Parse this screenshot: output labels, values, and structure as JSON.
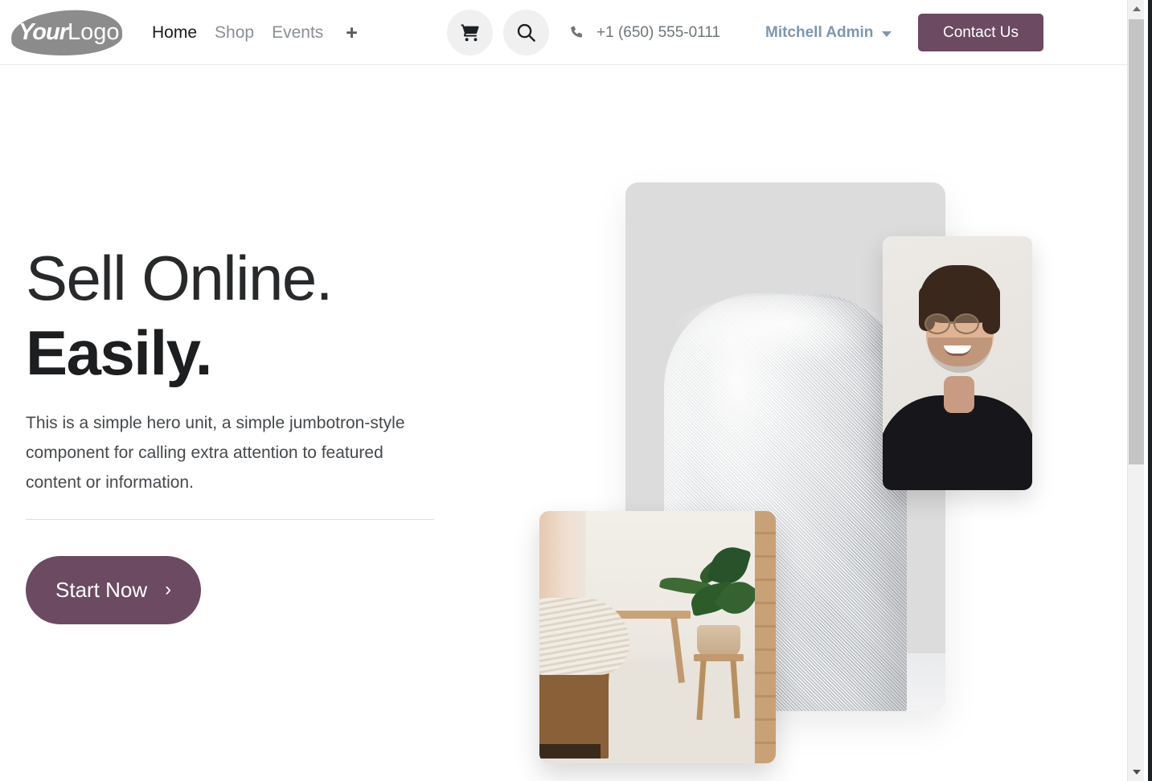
{
  "site": {
    "logo": {
      "part1": "Your",
      "part2": "Logo",
      "name": "your-logo"
    }
  },
  "navbar": {
    "links": [
      {
        "label": "Home",
        "active": true
      },
      {
        "label": "Shop",
        "active": false
      },
      {
        "label": "Events",
        "active": false
      }
    ],
    "add_page_icon": "+",
    "cart_icon": "shopping-cart-icon",
    "search_icon": "search-icon",
    "phone_icon": "phone-icon",
    "phone": "+1 (650) 555-0111",
    "user": "Mitchell Admin",
    "contact_label": "Contact Us",
    "accent_color": "#6b4a62",
    "user_color": "#7d97ad"
  },
  "hero": {
    "title_line1": "Sell Online.",
    "title_line2": "Easily.",
    "subtitle": "This is a simple hero unit, a simple jumbotron-style component for calling extra attention to featured content or information.",
    "cta_label": "Start Now",
    "cta_chevron": "›",
    "cta_color": "#6b4a62"
  },
  "collage": {
    "cards": [
      {
        "name": "speaker-image",
        "alt": "white mesh smart speaker on light background"
      },
      {
        "name": "portrait-image",
        "alt": "smiling man with glasses in black t-shirt"
      },
      {
        "name": "bedroom-image",
        "alt": "bedroom with wooden bench, plant on stool and wood floor"
      }
    ]
  },
  "scrollbar": {
    "up_arrow": "scroll-up-arrow-icon",
    "down_arrow": "scroll-down-arrow-icon",
    "thumb": "scrollbar-thumb"
  }
}
